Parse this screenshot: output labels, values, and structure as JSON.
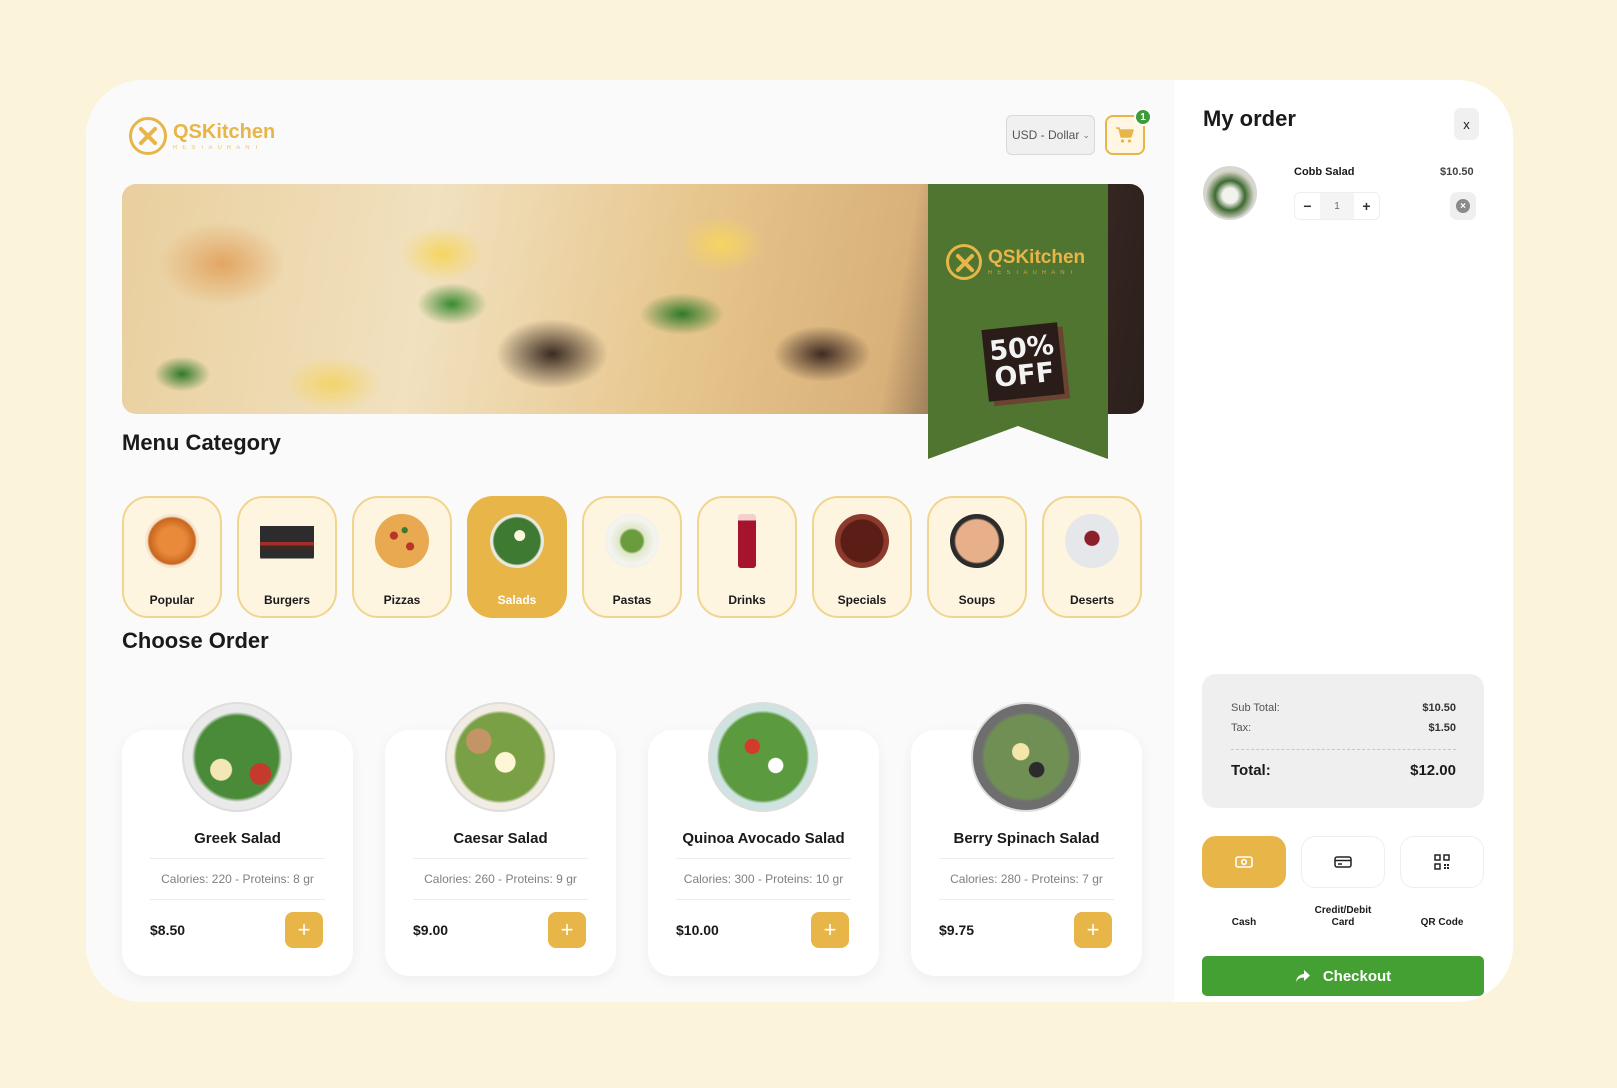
{
  "brand": {
    "name": "QSKitchen",
    "tagline": "RESTAURANT",
    "accent": "#e8b548",
    "green": "#45a033",
    "ribbon": "#4f7531"
  },
  "header": {
    "currency": "USD - Dollar",
    "cart_count": "1"
  },
  "hero": {
    "ribbon_brand": "QSKitchen",
    "ribbon_tagline": "RESTAURANT",
    "offer_line1": "50%",
    "offer_line2": "OFF"
  },
  "menu_category": {
    "title": "Menu Category",
    "items": [
      {
        "label": "Popular",
        "icon": "spaghetti-bowl-icon",
        "active": false
      },
      {
        "label": "Burgers",
        "icon": "burger-icon",
        "active": false
      },
      {
        "label": "Pizzas",
        "icon": "pizza-icon",
        "active": false
      },
      {
        "label": "Salads",
        "icon": "salad-icon",
        "active": true
      },
      {
        "label": "Pastas",
        "icon": "pasta-plate-icon",
        "active": false
      },
      {
        "label": "Drinks",
        "icon": "drink-glass-icon",
        "active": false
      },
      {
        "label": "Specials",
        "icon": "special-pot-icon",
        "active": false
      },
      {
        "label": "Soups",
        "icon": "soup-bowl-icon",
        "active": false
      },
      {
        "label": "Deserts",
        "icon": "dessert-plate-icon",
        "active": false
      }
    ]
  },
  "choose_order": {
    "title": "Choose Order",
    "items": [
      {
        "name": "Greek Salad",
        "meta": "Calories: 220 - Proteins: 8 gr",
        "price": "$8.50"
      },
      {
        "name": "Caesar Salad",
        "meta": "Calories: 260 - Proteins: 9 gr",
        "price": "$9.00"
      },
      {
        "name": "Quinoa Avocado Salad",
        "meta": "Calories: 300 - Proteins: 10 gr",
        "price": "$10.00"
      },
      {
        "name": "Berry Spinach Salad",
        "meta": "Calories: 280 - Proteins: 7 gr",
        "price": "$9.75"
      }
    ]
  },
  "order": {
    "title": "My order",
    "close_label": "x",
    "items": [
      {
        "name": "Cobb Salad",
        "price": "$10.50",
        "qty": "1"
      }
    ],
    "subtotal_label": "Sub Total:",
    "subtotal": "$10.50",
    "tax_label": "Tax:",
    "tax": "$1.50",
    "total_label": "Total:",
    "total": "$12.00",
    "payments": [
      {
        "label": "Cash",
        "icon": "cash-icon",
        "active": true
      },
      {
        "label": "Credit/Debit Card",
        "icon": "credit-card-icon",
        "active": false
      },
      {
        "label": "QR Code",
        "icon": "qr-code-icon",
        "active": false
      }
    ],
    "checkout_label": "Checkout"
  }
}
